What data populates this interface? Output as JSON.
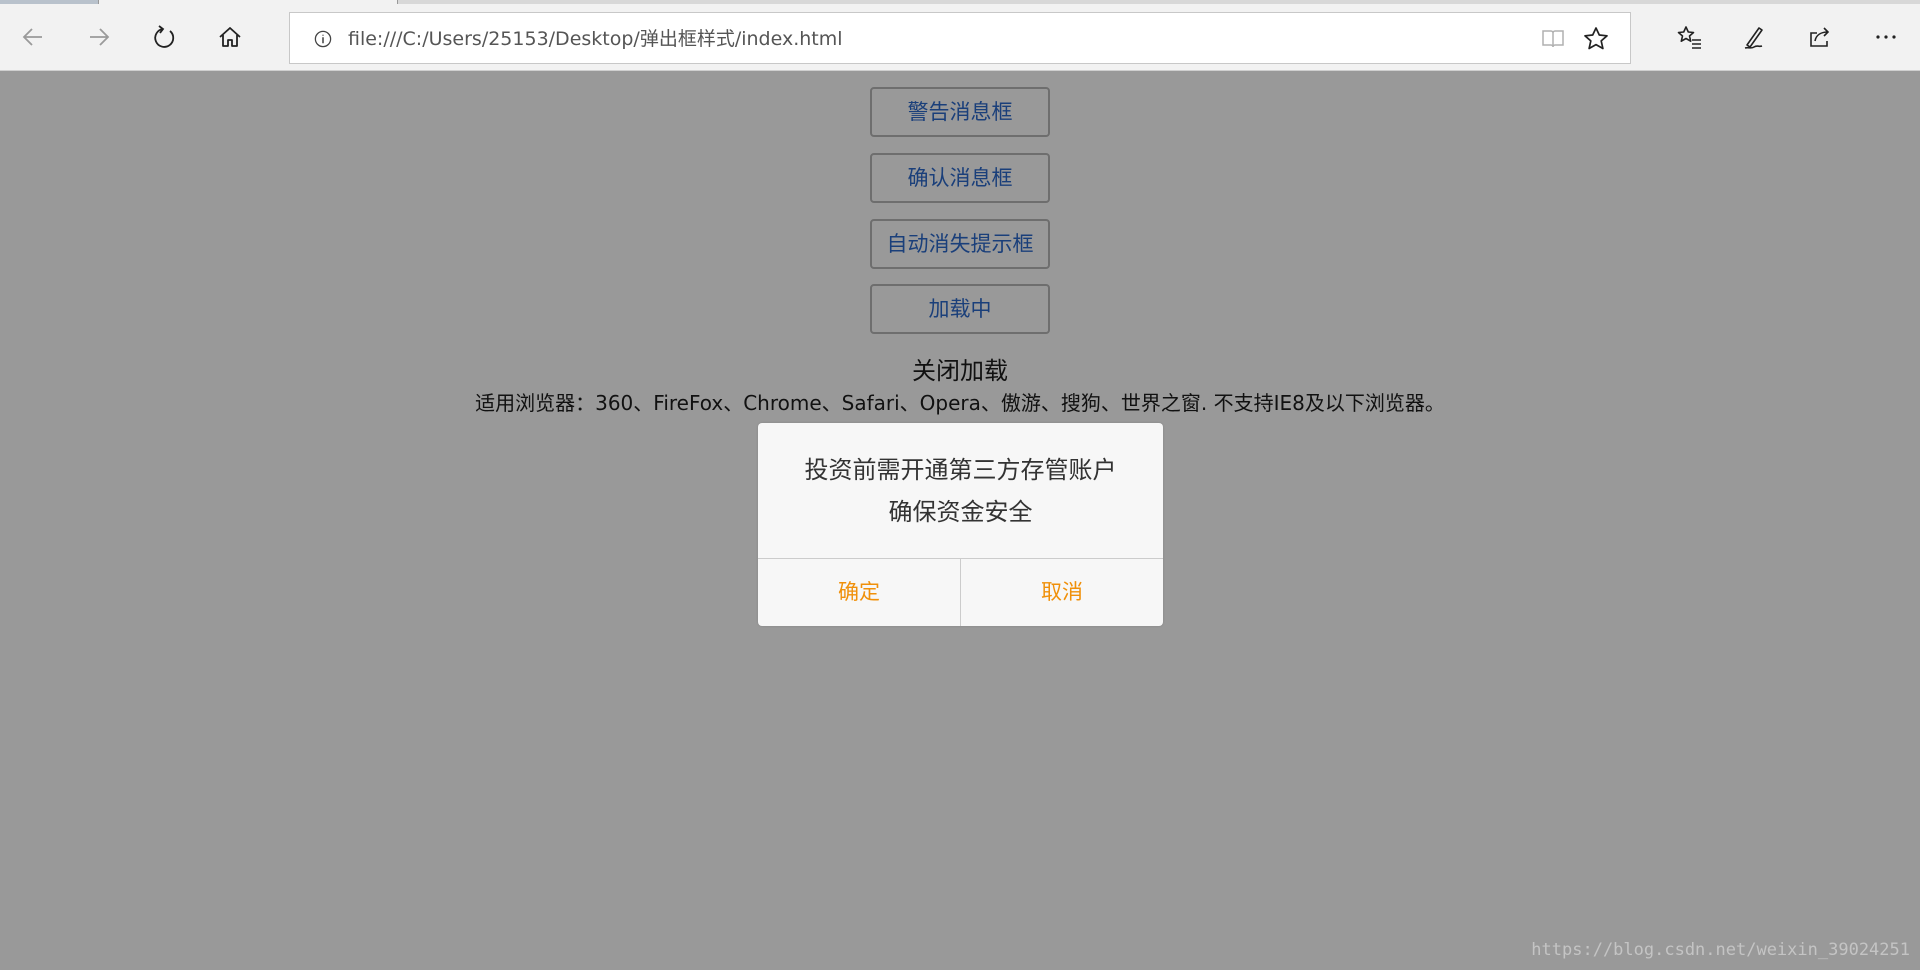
{
  "browser": {
    "url": "file:///C:/Users/25153/Desktop/弹出框样式/index.html",
    "icons": [
      "back-icon",
      "forward-icon",
      "refresh-icon",
      "home-icon",
      "info-icon",
      "reading-view-icon",
      "favorite-star-icon",
      "favorites-list-icon",
      "pen-icon",
      "share-icon",
      "more-icon"
    ]
  },
  "page": {
    "buttons": {
      "alert": "警告消息框",
      "confirm": "确认消息框",
      "toast": "自动消失提示框",
      "loading": "加载中"
    },
    "close_loading": "关闭加载",
    "browser_note": "适用浏览器：360、FireFox、Chrome、Safari、Opera、傲游、搜狗、世界之窗. 不支持IE8及以下浏览器。"
  },
  "modal": {
    "line1": "投资前需开通第三方存管账户",
    "line2": "确保资金安全",
    "ok_label": "确定",
    "cancel_label": "取消",
    "button_color": "#f0900a"
  },
  "watermark": "https://blog.csdn.net/weixin_39024251"
}
